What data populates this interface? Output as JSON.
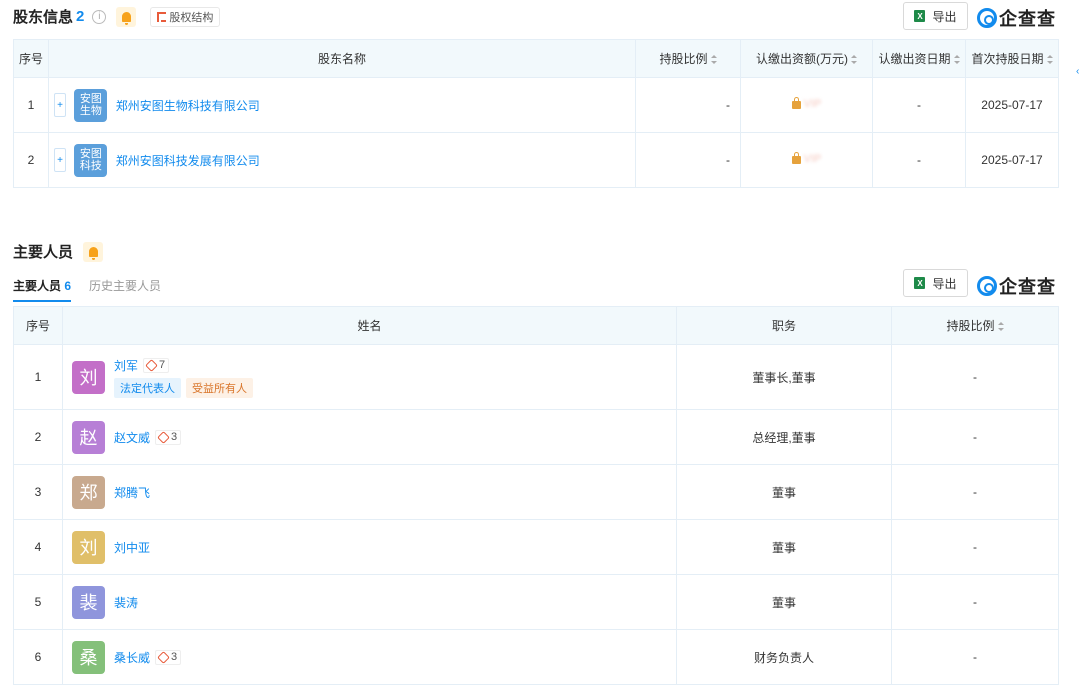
{
  "shareholders": {
    "title": "股东信息",
    "count": "2",
    "info_glyph": "i",
    "structure_label": "股权结构",
    "export_label": "导出",
    "logo_text": "企查查",
    "headers": [
      "序号",
      "股东名称",
      "持股比例",
      "认缴出资额(万元)",
      "认缴出资日期",
      "首次持股日期"
    ],
    "rows": [
      {
        "index": "1",
        "logo": "安图生物",
        "name": "郑州安图生物科技有限公司",
        "ratio": "-",
        "amount_hidden": "VIP",
        "subscribe_date": "-",
        "first_date": "2025-07-17"
      },
      {
        "index": "2",
        "logo": "安图科技",
        "name": "郑州安图科技发展有限公司",
        "ratio": "-",
        "amount_hidden": "VIP",
        "subscribe_date": "-",
        "first_date": "2025-07-17"
      }
    ]
  },
  "personnel": {
    "title": "主要人员",
    "tabs": [
      {
        "label": "主要人员",
        "count": "6"
      },
      {
        "label": "历史主要人员",
        "count": ""
      }
    ],
    "export_label": "导出",
    "logo_text": "企查查",
    "headers": [
      "序号",
      "姓名",
      "职务",
      "持股比例"
    ],
    "rows": [
      {
        "index": "1",
        "avatar": "刘",
        "color": "#c36fc8",
        "name": "刘军",
        "relations": "7",
        "badges": [
          "法定代表人",
          "受益所有人"
        ],
        "role": "董事长,董事",
        "ratio": "-"
      },
      {
        "index": "2",
        "avatar": "赵",
        "color": "#b77fd6",
        "name": "赵文威",
        "relations": "3",
        "badges": [],
        "role": "总经理,董事",
        "ratio": "-"
      },
      {
        "index": "3",
        "avatar": "郑",
        "color": "#c8a98e",
        "name": "郑腾飞",
        "relations": "",
        "badges": [],
        "role": "董事",
        "ratio": "-"
      },
      {
        "index": "4",
        "avatar": "刘",
        "color": "#e0bf69",
        "name": "刘中亚",
        "relations": "",
        "badges": [],
        "role": "董事",
        "ratio": "-"
      },
      {
        "index": "5",
        "avatar": "裴",
        "color": "#8f95dc",
        "name": "裴涛",
        "relations": "",
        "badges": [],
        "role": "董事",
        "ratio": "-"
      },
      {
        "index": "6",
        "avatar": "桑",
        "color": "#84c07a",
        "name": "桑长威",
        "relations": "3",
        "badges": [],
        "role": "财务负责人",
        "ratio": "-"
      }
    ]
  }
}
